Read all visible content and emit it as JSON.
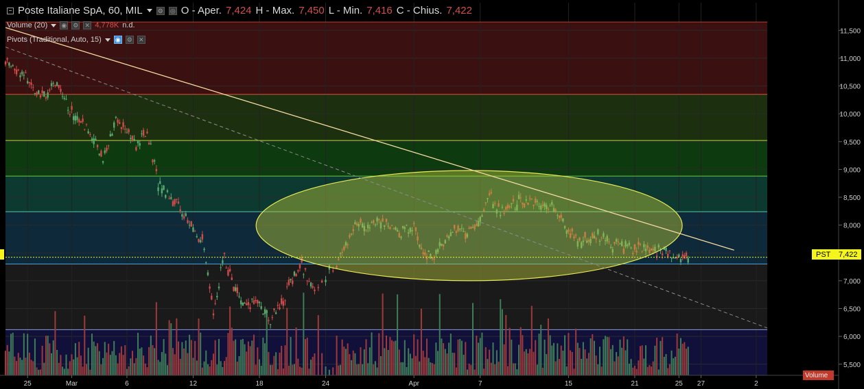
{
  "legend": {
    "symbol": "Poste Italiane SpA, 60, MIL",
    "open_label": "O - Aper.",
    "open_value": "7,424",
    "high_label": "H - Max.",
    "high_value": "7,450",
    "low_label": "L - Min.",
    "low_value": "7,416",
    "close_label": "C - Chius.",
    "close_value": "7,422",
    "volume_label": "Volume (20)",
    "volume_value": "4,778K",
    "volume_na": "n.d.",
    "pivots_label": "Pivots (Traditional, Auto, 15)"
  },
  "price_tag": {
    "symbol": "PST",
    "value": "7,422"
  },
  "volume_tag": "Volume",
  "colors": {
    "up": "#5aa86c",
    "down": "#d14a4a",
    "volume_up": "#3f7d58",
    "volume_down": "#9e3a3a",
    "ellipse_fill": "#b8c53a",
    "ellipse_stroke": "#e8ea5a",
    "trendline": "#f2d9a0",
    "dashed": "#8c8c8c",
    "last_price": "#f5f51e"
  },
  "chart_data": {
    "type": "candlestick",
    "timeframe": "60",
    "y_axis": {
      "ticks": [
        "11,500",
        "11,000",
        "10,500",
        "10,000",
        "9,500",
        "9,000",
        "8,500",
        "8,000",
        "7,500",
        "7,000",
        "6,500",
        "6,000",
        "5,500"
      ],
      "ylim": [
        5.3,
        11.75
      ]
    },
    "x_axis": {
      "ticks": [
        {
          "label": "25",
          "date": "2019-02-25"
        },
        {
          "label": "Mar",
          "date": "2019-03-01"
        },
        {
          "label": "6",
          "date": "2019-03-06"
        },
        {
          "label": "12",
          "date": "2019-03-12"
        },
        {
          "label": "18",
          "date": "2019-03-18"
        },
        {
          "label": "24",
          "date": "2019-03-24"
        },
        {
          "label": "Apr",
          "date": "2019-04-01"
        },
        {
          "label": "7",
          "date": "2019-04-07"
        },
        {
          "label": "15",
          "date": "2019-04-15"
        },
        {
          "label": "21",
          "date": "2019-04-21"
        },
        {
          "label": "25",
          "date": "2019-04-25"
        },
        {
          "label": "27",
          "date": "2019-04-27"
        },
        {
          "label": "2",
          "date": "2019-05-02"
        }
      ]
    },
    "last_price": 7.422,
    "pivot_levels": [
      {
        "value": 11.65,
        "color": "#c0392b"
      },
      {
        "value": 10.35,
        "color": "#e0503a"
      },
      {
        "value": 9.52,
        "color": "#b8d838"
      },
      {
        "value": 8.88,
        "color": "#6cc84a"
      },
      {
        "value": 8.24,
        "color": "#5fc8a0"
      },
      {
        "value": 7.3,
        "color": "#4aa0d8"
      },
      {
        "value": 6.12,
        "color": "#8c9cd8"
      }
    ],
    "zones": [
      {
        "from": 10.35,
        "to": 11.65,
        "color": "#3a1010"
      },
      {
        "from": 9.52,
        "to": 10.35,
        "color": "#1c3010"
      },
      {
        "from": 8.88,
        "to": 9.52,
        "color": "#0e3a10"
      },
      {
        "from": 8.24,
        "to": 8.88,
        "color": "#0c3a30"
      },
      {
        "from": 7.3,
        "to": 8.24,
        "color": "#0e2a3a"
      },
      {
        "from": 6.12,
        "to": 7.3,
        "color": "#1a1a1a"
      },
      {
        "from": 5.3,
        "to": 6.12,
        "color": "#10103a"
      }
    ],
    "trendline": {
      "from": {
        "date": "2019-02-23",
        "price": 11.55
      },
      "to": {
        "date": "2019-04-30",
        "price": 7.55
      }
    },
    "dashed_trend": {
      "from": {
        "date": "2019-02-23",
        "price": 11.2
      },
      "to": {
        "date": "2019-05-03",
        "price": 6.15
      }
    },
    "ellipse": {
      "center": {
        "date": "2019-04-06",
        "price": 7.99
      },
      "radius_days": 19.3,
      "radius_price": 0.99
    },
    "candles": [
      {
        "date": "2019-02-23",
        "close": 10.85
      },
      {
        "date": "2019-02-24",
        "close": 10.65
      },
      {
        "date": "2019-02-25",
        "close": 10.45
      },
      {
        "date": "2019-02-26",
        "close": 10.35
      },
      {
        "date": "2019-02-27",
        "close": 10.55
      },
      {
        "date": "2019-02-28",
        "close": 10.05
      },
      {
        "date": "2019-03-01",
        "close": 9.85
      },
      {
        "date": "2019-03-02",
        "close": 9.65
      },
      {
        "date": "2019-03-03",
        "close": 9.2
      },
      {
        "date": "2019-03-04",
        "close": 9.8
      },
      {
        "date": "2019-03-05",
        "close": 9.85
      },
      {
        "date": "2019-03-06",
        "close": 9.4
      },
      {
        "date": "2019-03-07",
        "close": 9.7
      },
      {
        "date": "2019-03-08",
        "close": 8.75
      },
      {
        "date": "2019-03-09",
        "close": 8.55
      },
      {
        "date": "2019-03-10",
        "close": 8.3
      },
      {
        "date": "2019-03-11",
        "close": 7.95
      },
      {
        "date": "2019-03-12",
        "close": 7.7
      },
      {
        "date": "2019-03-13",
        "close": 6.45
      },
      {
        "date": "2019-03-14",
        "close": 7.45
      },
      {
        "date": "2019-03-15",
        "close": 6.8
      },
      {
        "date": "2019-03-16",
        "close": 6.5
      },
      {
        "date": "2019-03-17",
        "close": 6.7
      },
      {
        "date": "2019-03-18",
        "close": 6.3
      },
      {
        "date": "2019-03-19",
        "close": 6.5
      },
      {
        "date": "2019-03-20",
        "close": 7.0
      },
      {
        "date": "2019-03-21",
        "close": 7.3
      },
      {
        "date": "2019-03-22",
        "close": 6.8
      },
      {
        "date": "2019-03-23",
        "close": 7.2
      },
      {
        "date": "2019-03-25",
        "close": 7.7
      },
      {
        "date": "2019-03-26",
        "close": 8.05
      },
      {
        "date": "2019-03-27",
        "close": 7.95
      },
      {
        "date": "2019-03-28",
        "close": 8.1
      },
      {
        "date": "2019-03-29",
        "close": 7.95
      },
      {
        "date": "2019-03-30",
        "close": 7.85
      },
      {
        "date": "2019-03-31",
        "close": 8.0
      },
      {
        "date": "2019-04-01",
        "close": 7.55
      },
      {
        "date": "2019-04-02",
        "close": 7.4
      },
      {
        "date": "2019-04-03",
        "close": 7.75
      },
      {
        "date": "2019-04-04",
        "close": 7.95
      },
      {
        "date": "2019-04-05",
        "close": 7.85
      },
      {
        "date": "2019-04-06",
        "close": 8.05
      },
      {
        "date": "2019-04-07",
        "close": 8.55
      },
      {
        "date": "2019-04-08",
        "close": 8.2
      },
      {
        "date": "2019-04-09",
        "close": 8.35
      },
      {
        "date": "2019-04-10",
        "close": 8.45
      },
      {
        "date": "2019-04-11",
        "close": 8.4
      },
      {
        "date": "2019-04-12",
        "close": 8.35
      },
      {
        "date": "2019-04-13",
        "close": 8.3
      },
      {
        "date": "2019-04-14",
        "close": 7.9
      },
      {
        "date": "2019-04-15",
        "close": 7.7
      },
      {
        "date": "2019-04-16",
        "close": 7.75
      },
      {
        "date": "2019-04-17",
        "close": 7.8
      },
      {
        "date": "2019-04-18",
        "close": 7.65
      },
      {
        "date": "2019-04-19",
        "close": 7.6
      },
      {
        "date": "2019-04-20",
        "close": 7.55
      },
      {
        "date": "2019-04-21",
        "close": 7.6
      },
      {
        "date": "2019-04-22",
        "close": 7.55
      },
      {
        "date": "2019-04-23",
        "close": 7.5
      },
      {
        "date": "2019-04-24",
        "close": 7.45
      },
      {
        "date": "2019-04-25",
        "close": 7.422
      }
    ]
  }
}
